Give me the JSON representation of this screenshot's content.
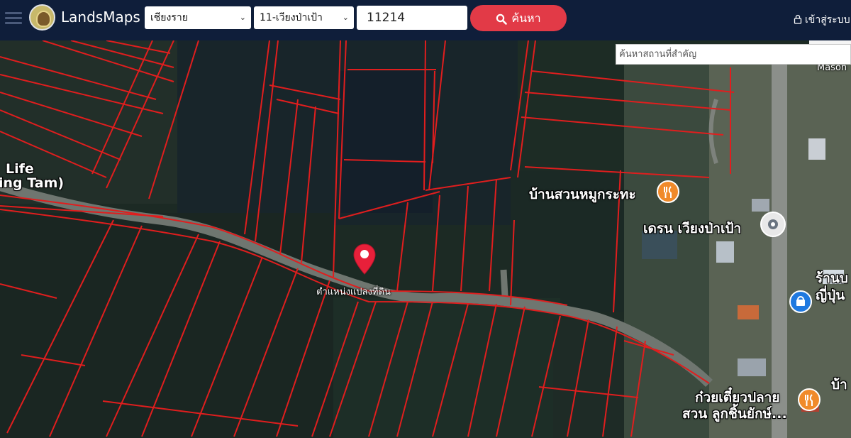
{
  "header": {
    "brand": "LandsMaps",
    "province_select": "เชียงราย",
    "district_select": "11-เวียงป่าเป้า",
    "parcel_number": "11214",
    "search_button": "ค้นหา",
    "login_link": "เข้าสู่ระบบ"
  },
  "map": {
    "landmark_search_placeholder": "ค้นหาสถานที่สำคัญ",
    "pin_label": "ตำแหน่งแปลงที่ดิน",
    "pois": [
      {
        "label": "บ้านสวนหมูกระทะ"
      },
      {
        "label": "เดรน เวียงป่าเป้า"
      },
      {
        "label": "ก๋วยเตี๋ยวปลาย"
      },
      {
        "label": "สวน ลูกชิ้นยักษ์..."
      },
      {
        "label": "ร้านบ"
      },
      {
        "label": "ญี่ปุ่น"
      },
      {
        "label": "บ้า"
      }
    ],
    "edge_labels": [
      "Life",
      "ing Tam)",
      "Mason"
    ],
    "colors": {
      "parcel_line": "#e01e1e",
      "pin": "#e8203a",
      "food_poi": "#f08a2a",
      "shop_poi": "#1f79e0"
    }
  }
}
